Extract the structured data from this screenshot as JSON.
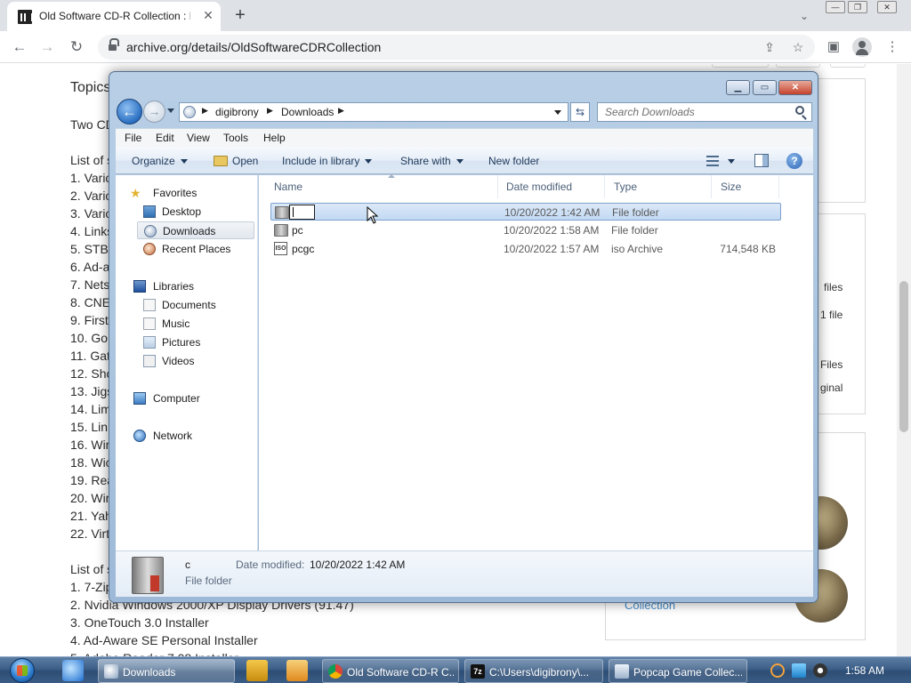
{
  "browser": {
    "tab_title": "Old Software CD-R Collection : F",
    "url": "archive.org/details/OldSoftwareCDRCollection"
  },
  "page": {
    "topics_heading": "Topics",
    "intro_fragment": "Two CD",
    "list_a_heading": "List of s",
    "list_a": [
      "1. Vario",
      "2. Vario",
      "3. Vario",
      "4. Links",
      "5. STB",
      "6. Ad-a",
      "7. Nets",
      "8. CNE",
      "9. First",
      "10. Go",
      "11. Gat",
      "12. Sho",
      "13. Jigs",
      "14. Lim",
      "15. Lin",
      "16. Wir",
      "18. Wic",
      "19. Rea",
      "20. Wir",
      "21. Yah",
      "22. Virt"
    ],
    "list_b_heading": "List of s",
    "list_b": [
      "1. 7-Zip",
      "2. Nvidia Windows 2000/XP Display Drivers (91.47)",
      "3. OneTouch 3.0 Installer",
      "4. Ad-Aware SE Personal Installer",
      "5. Adobe Reader 7.08 Installer"
    ],
    "side_files": "files",
    "side_one_file": "1 file",
    "side_files2": "Files",
    "side_original": "ginal",
    "side_collection": "Collection"
  },
  "explorer": {
    "address": {
      "crumbs": [
        "digibrony",
        "Downloads"
      ]
    },
    "search_placeholder": "Search Downloads",
    "menu": [
      "File",
      "Edit",
      "View",
      "Tools",
      "Help"
    ],
    "commands": {
      "organize": "Organize",
      "open": "Open",
      "include": "Include in library",
      "share": "Share with",
      "new_folder": "New folder"
    },
    "nav": {
      "favorites": "Favorites",
      "desktop": "Desktop",
      "downloads": "Downloads",
      "recent": "Recent Places",
      "libraries": "Libraries",
      "documents": "Documents",
      "music": "Music",
      "pictures": "Pictures",
      "videos": "Videos",
      "computer": "Computer",
      "network": "Network"
    },
    "columns": {
      "name": "Name",
      "date": "Date modified",
      "type": "Type",
      "size": "Size"
    },
    "files": [
      {
        "name": "",
        "date": "10/20/2022 1:42 AM",
        "type": "File folder",
        "size": ""
      },
      {
        "name": "pc",
        "date": "10/20/2022 1:58 AM",
        "type": "File folder",
        "size": ""
      },
      {
        "name": "pcgc",
        "date": "10/20/2022 1:57 AM",
        "type": "iso Archive",
        "size": "714,548 KB"
      }
    ],
    "details": {
      "name": "c",
      "date_label": "Date modified:",
      "date_value": "10/20/2022 1:42 AM",
      "type": "File folder"
    }
  },
  "taskbar": {
    "tasks": [
      {
        "label": "Downloads"
      },
      {
        "label": "Old Software CD-R C..."
      },
      {
        "label": "C:\\Users\\digibrony\\..."
      },
      {
        "label": "Popcap Game Collec..."
      }
    ],
    "clock": "1:58 AM"
  },
  "colors": {
    "selection": "#c2d9f3",
    "taskbar": "#3c5f88",
    "explorer_frame": "#a9c3de"
  }
}
